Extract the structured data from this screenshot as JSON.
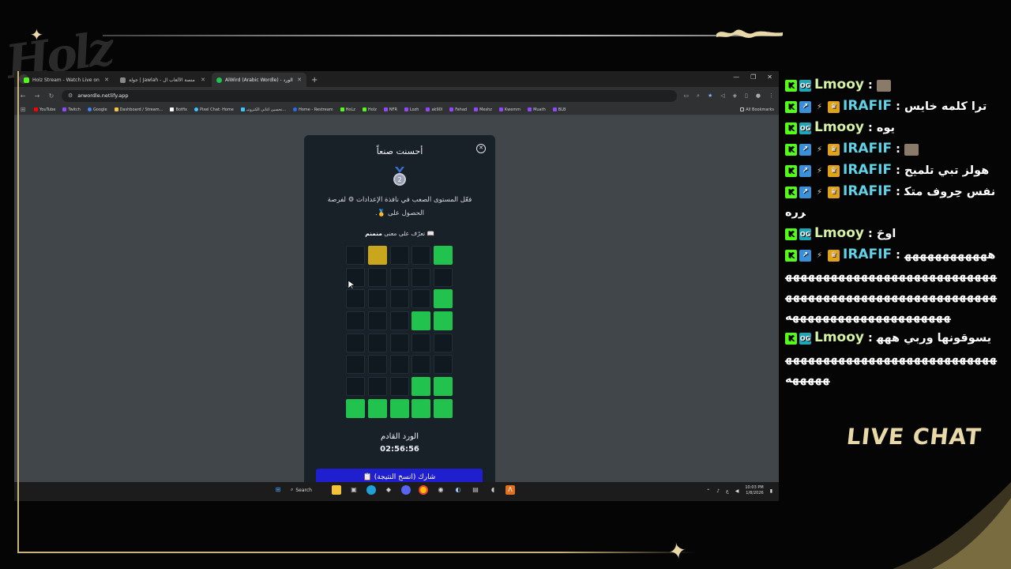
{
  "overlay": {
    "logo_text": "Holz",
    "live_chat_label": "LIVE CHAT"
  },
  "browser": {
    "tabs": [
      {
        "label": "Holz Stream - Watch Live on Ki",
        "active": false,
        "color": "#53fc18"
      },
      {
        "label": "جولة | Jawlah - منصة الألعاب ال",
        "active": false,
        "color": "#888888"
      },
      {
        "label": "AlWird (Arabic Wordle) - الورد",
        "active": true,
        "color": "#22c24e"
      }
    ],
    "new_tab": "+",
    "url": "arwordle.netlify.app",
    "bookmarks": [
      {
        "label": "YouTube",
        "color": "#ff0000"
      },
      {
        "label": "Twitch",
        "color": "#9146ff"
      },
      {
        "label": "Google",
        "color": "#4285f4"
      },
      {
        "label": "Dashboard / Stream...",
        "color": "#f6c343"
      },
      {
        "label": "Botfix",
        "color": "#ffffff"
      },
      {
        "label": "Pixel Chat: Home",
        "color": "#40c4ff"
      },
      {
        "label": "تحسين اغاني الكترونيـ...",
        "color": "#40c4ff"
      },
      {
        "label": "Home - Restream",
        "color": "#2a6cf0"
      },
      {
        "label": "HoLz",
        "color": "#53fc18"
      },
      {
        "label": "HoIz",
        "color": "#53fc18"
      },
      {
        "label": "NFR",
        "color": "#9146ff"
      },
      {
        "label": "Lozh",
        "color": "#9146ff"
      },
      {
        "label": "ak90l",
        "color": "#9146ff"
      },
      {
        "label": "Fahad",
        "color": "#9146ff"
      },
      {
        "label": "Meshz",
        "color": "#9146ff"
      },
      {
        "label": "Kwemm",
        "color": "#9146ff"
      },
      {
        "label": "Muath",
        "color": "#9146ff"
      },
      {
        "label": "BLB",
        "color": "#9146ff"
      }
    ],
    "all_bookmarks": "All Bookmarks"
  },
  "modal": {
    "title": "أحسنت صنعاً",
    "medal_number": "2",
    "hint_line1": "فعّل المستوى الصعب في نافذة الإعدادات ⚙ لفرصة",
    "hint_line2": "الحصول على 🥇.",
    "meaning_prefix": "تعرّف على معنى",
    "meaning_word": "منمنم",
    "grid": [
      [
        "e",
        "y",
        "e",
        "e",
        "g"
      ],
      [
        "e",
        "e",
        "e",
        "e",
        "e"
      ],
      [
        "e",
        "e",
        "e",
        "e",
        "g"
      ],
      [
        "e",
        "e",
        "e",
        "g",
        "g"
      ],
      [
        "e",
        "e",
        "e",
        "e",
        "e"
      ],
      [
        "e",
        "e",
        "e",
        "e",
        "e"
      ],
      [
        "e",
        "e",
        "e",
        "g",
        "g"
      ],
      [
        "g",
        "g",
        "g",
        "g",
        "g"
      ]
    ],
    "next_label": "الورد القادم",
    "countdown": "02:56:56",
    "share_label": "شارك (انسخ النتيجة) 📋"
  },
  "taskbar": {
    "search_label": "Search",
    "time": "10:03 PM",
    "date": "1/8/2026"
  },
  "chat": {
    "messages": [
      {
        "user": "Lmooy",
        "user_color": "green",
        "badges": [
          "k",
          "og"
        ],
        "text": "",
        "emote": true
      },
      {
        "user": "IRAFIF",
        "user_color": "blue",
        "badges": [
          "k",
          "sub",
          "flash",
          "crown"
        ],
        "text": "ترا كلمه خايس"
      },
      {
        "user": "Lmooy",
        "user_color": "green",
        "badges": [
          "k",
          "og"
        ],
        "text": "يوه"
      },
      {
        "user": "IRAFIF",
        "user_color": "blue",
        "badges": [
          "k",
          "sub",
          "flash",
          "crown"
        ],
        "text": "",
        "emote": true
      },
      {
        "user": "IRAFIF",
        "user_color": "blue",
        "badges": [
          "k",
          "sub",
          "flash",
          "crown"
        ],
        "text": "هولز تبي تلميح"
      },
      {
        "user": "IRAFIF",
        "user_color": "blue",
        "badges": [
          "k",
          "sub",
          "flash",
          "crown"
        ],
        "text": "نفس حِروف متكرره"
      },
      {
        "user": "Lmooy",
        "user_color": "green",
        "badges": [
          "k",
          "og"
        ],
        "text": "اوحَ"
      },
      {
        "user": "IRAFIF",
        "user_color": "blue",
        "badges": [
          "k",
          "sub",
          "flash",
          "crown"
        ],
        "text": "هههههههههههههههههههههههههههههههههههههههههههههههههههههههههههههههههههههههههههههههههههههههههه"
      },
      {
        "user": "Lmooy",
        "user_color": "green",
        "badges": [
          "k",
          "og"
        ],
        "text": "يسوقونها وربي ههههههههههههههههههههههههههههههههههههه"
      }
    ]
  }
}
